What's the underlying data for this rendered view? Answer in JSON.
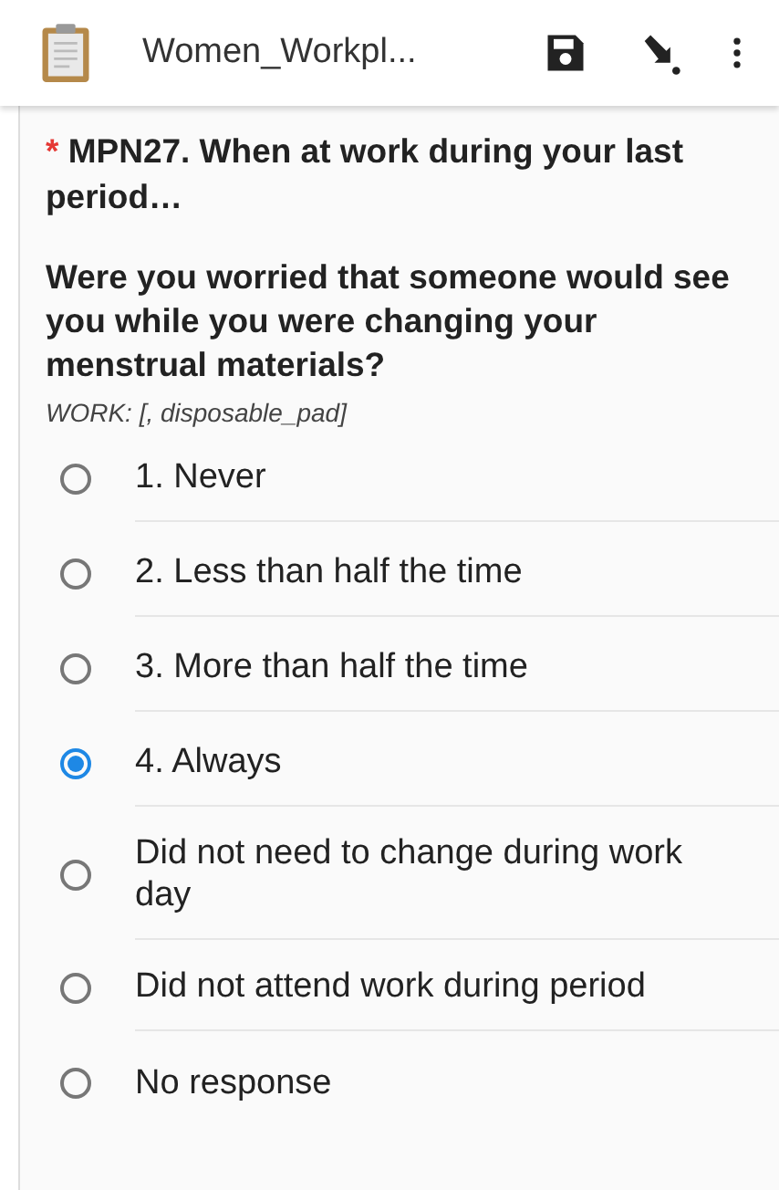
{
  "toolbar": {
    "title": "Women_Workpl..."
  },
  "question": {
    "required_mark": "*",
    "heading": "MPN27. When at work during your last period…",
    "text": "Were you worried that someone would see you while you were changing your menstrual materials?",
    "hint": "WORK: [, disposable_pad]"
  },
  "options": [
    {
      "label": "1. Never",
      "selected": false
    },
    {
      "label": "2. Less than half the time",
      "selected": false
    },
    {
      "label": "3. More than half the time",
      "selected": false
    },
    {
      "label": "4. Always",
      "selected": true
    },
    {
      "label": "Did not need to change during work day",
      "selected": false
    },
    {
      "label": "Did not attend work during period",
      "selected": false
    },
    {
      "label": "No response",
      "selected": false
    }
  ]
}
